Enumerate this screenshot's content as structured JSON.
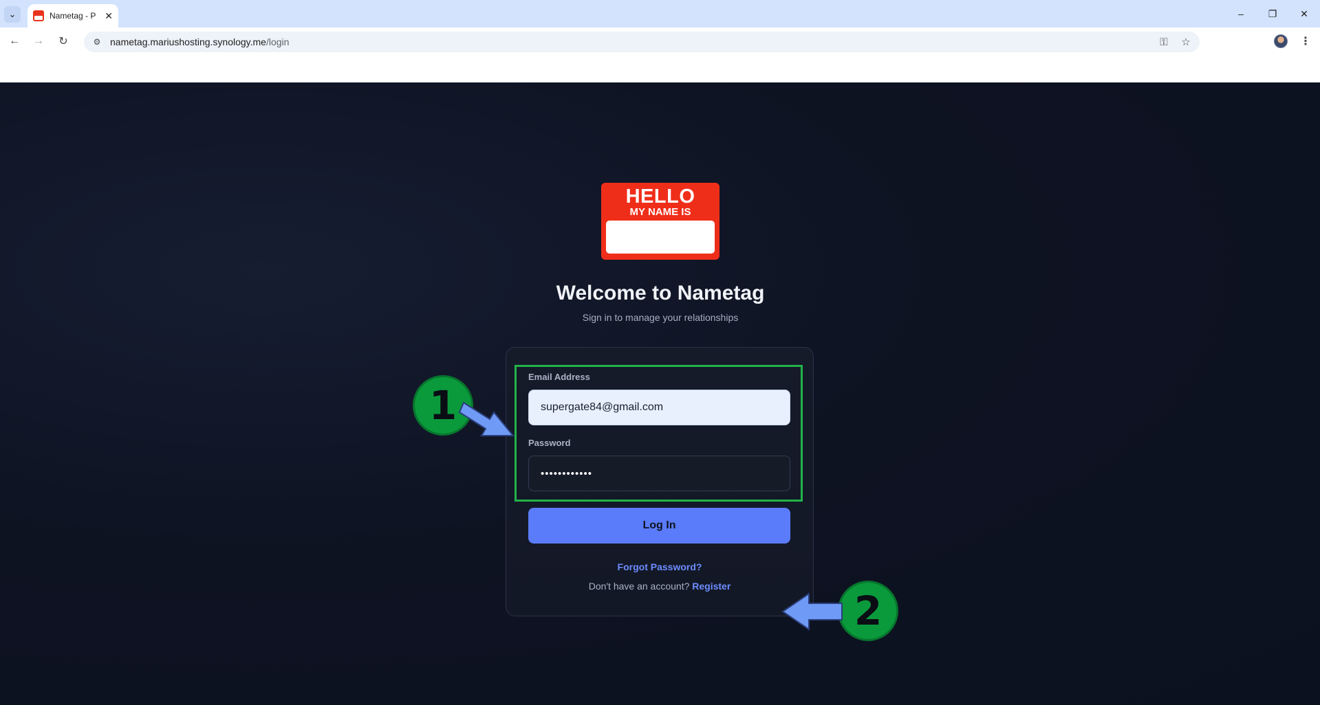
{
  "browser": {
    "tab_title": "Nametag - P",
    "tab_close": "✕",
    "tab_menu_icon": "chevron-down-icon",
    "url_host": "nametag.mariushosting.synology.me",
    "url_path": "/login",
    "window_controls": [
      "–",
      "❐",
      "✕"
    ]
  },
  "logo": {
    "hello": "HELLO",
    "my_name_is": "MY NAME IS"
  },
  "login": {
    "title": "Welcome to Nametag",
    "subtitle": "Sign in to manage your relationships",
    "email_label": "Email Address",
    "email_value": "supergate84@gmail.com",
    "password_label": "Password",
    "password_value": "••••••••••••",
    "login_button": "Log In",
    "forgot_password": "Forgot Password?",
    "no_account_text": "Don't have an account?",
    "register_link": "Register"
  },
  "annotations": {
    "step1": "1",
    "step2": "2",
    "highlight_color": "#23b34a",
    "arrow_color": "#6f9af5"
  },
  "colors": {
    "background": "#0e1322",
    "accent": "#5b7cfa",
    "logo_red": "#ef2e1a"
  }
}
